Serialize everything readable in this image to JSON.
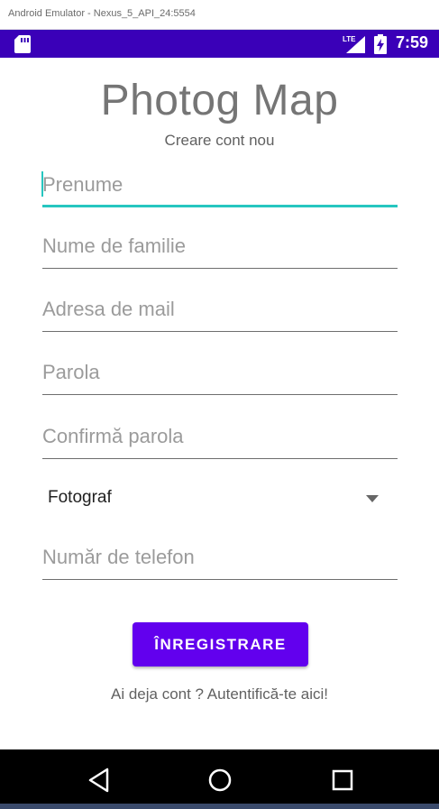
{
  "window": {
    "title": "Android Emulator - Nexus_5_API_24:5554"
  },
  "status_bar": {
    "time": "7:59",
    "network_label": "LTE",
    "icons": [
      "sd-card-icon",
      "lte-signal-icon",
      "battery-charging-icon"
    ],
    "background_color": "#3a00b8"
  },
  "app": {
    "title": "Photog Map",
    "subtitle": "Creare cont nou",
    "fields": {
      "first_name": {
        "placeholder": "Prenume",
        "value": ""
      },
      "last_name": {
        "placeholder": "Nume de familie",
        "value": ""
      },
      "email": {
        "placeholder": "Adresa de mail",
        "value": ""
      },
      "password": {
        "placeholder": "Parola",
        "value": ""
      },
      "confirm_password": {
        "placeholder": "Confirmă parola",
        "value": ""
      },
      "phone": {
        "placeholder": "Număr de telefon",
        "value": ""
      }
    },
    "role_spinner": {
      "selected": "Fotograf"
    },
    "register_button": "ÎNREGISTRARE",
    "login_link": "Ai deja cont ? Autentifică-te aici!",
    "accent_color": "#6200ee",
    "focus_color": "#26c6c0"
  },
  "nav_bar": {
    "icons": [
      "back-icon",
      "home-icon",
      "recents-icon"
    ]
  }
}
